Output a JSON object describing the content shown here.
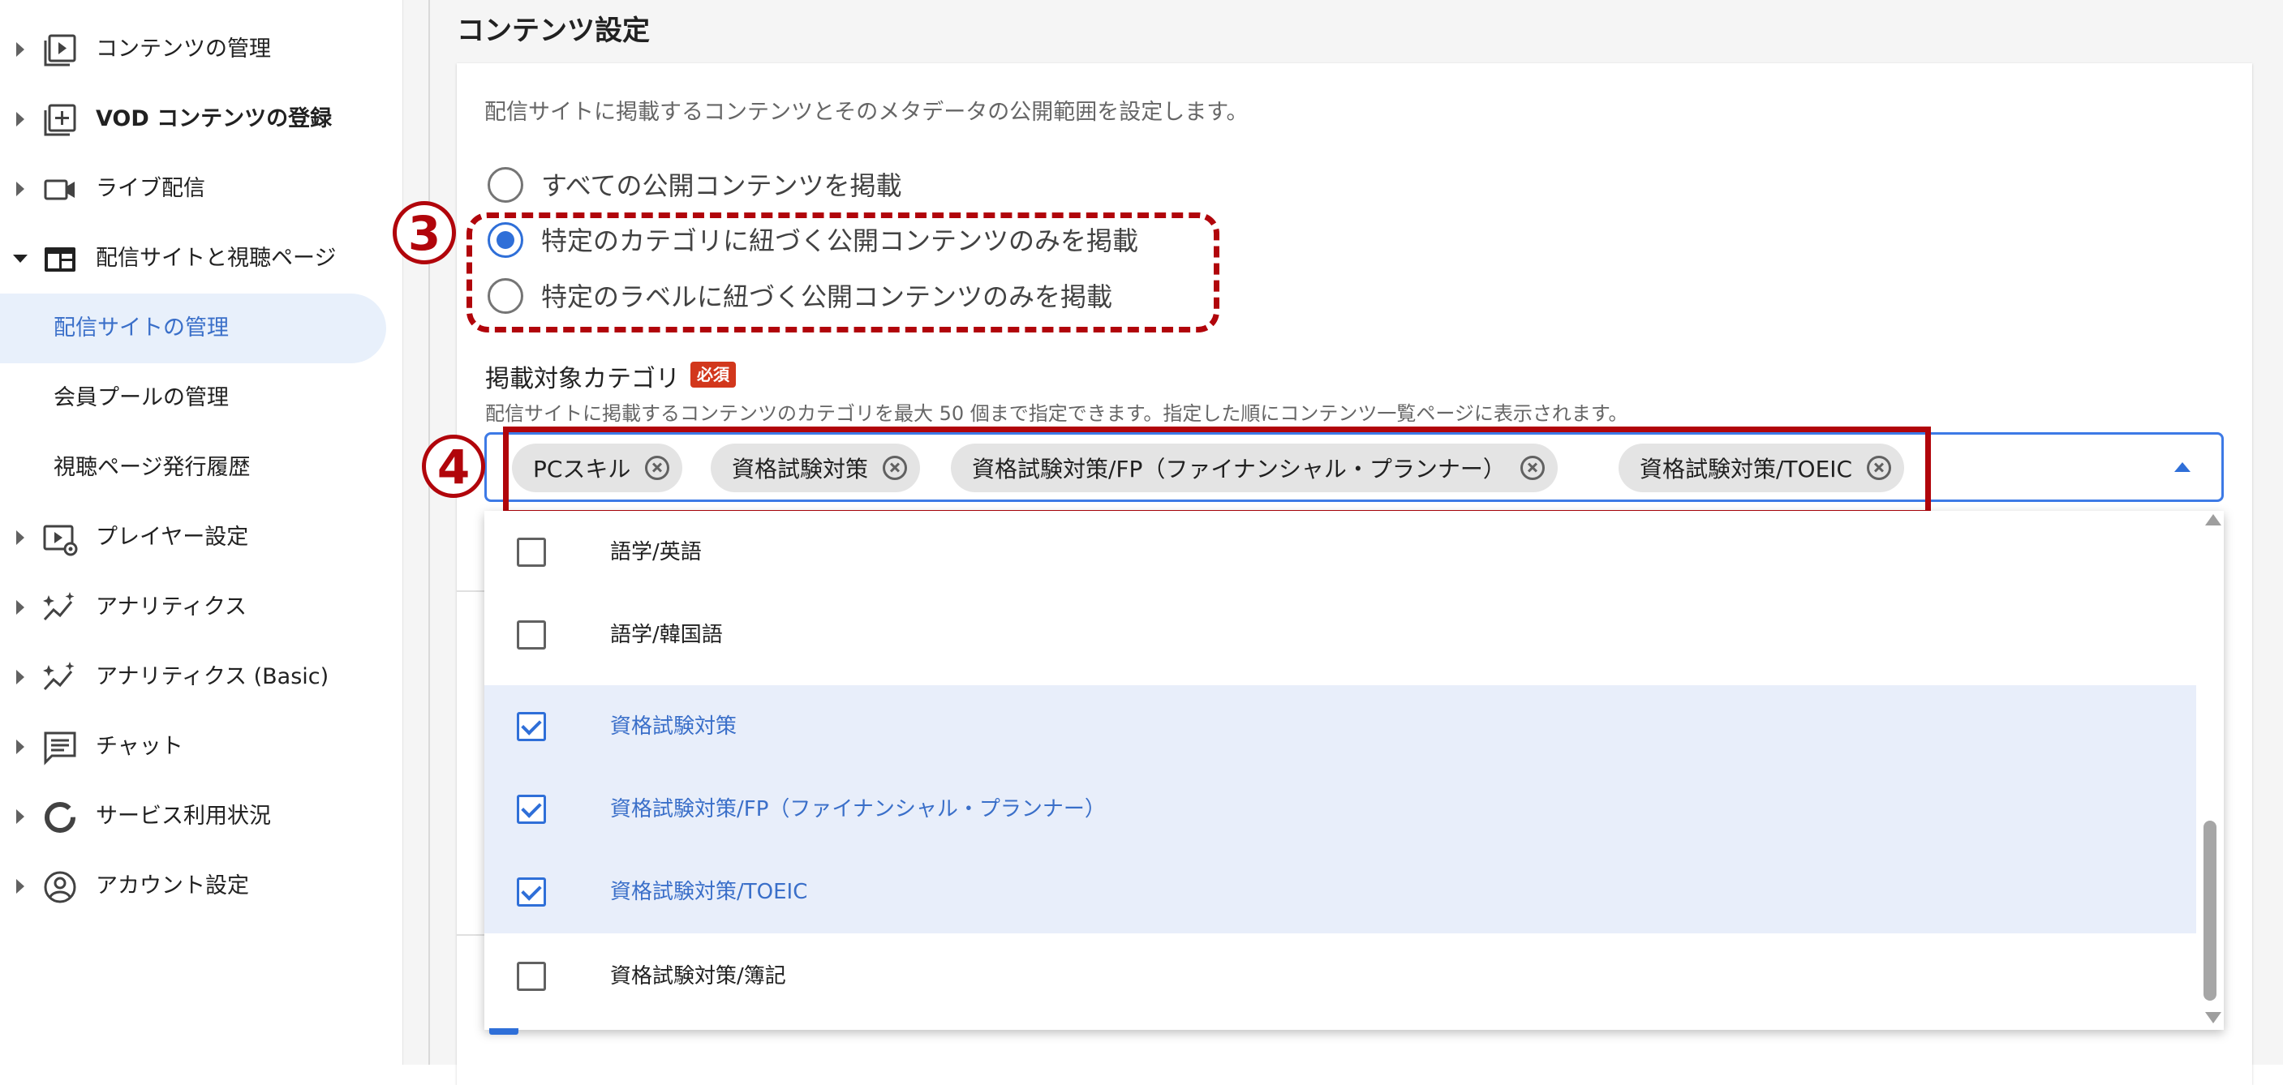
{
  "sidebar": {
    "items": [
      {
        "label": "コンテンツの管理",
        "icon": "play-library-icon"
      },
      {
        "label": "VOD コンテンツの登録",
        "icon": "add-library-icon"
      },
      {
        "label": "ライブ配信",
        "icon": "video-camera-icon"
      },
      {
        "label": "配信サイトと視聴ページ",
        "icon": "web-page-icon"
      },
      {
        "label": "プレイヤー設定",
        "icon": "player-settings-icon"
      },
      {
        "label": "アナリティクス",
        "icon": "analytics-icon"
      },
      {
        "label": "アナリティクス (Basic)",
        "icon": "analytics-icon"
      },
      {
        "label": "チャット",
        "icon": "chat-icon"
      },
      {
        "label": "サービス利用状況",
        "icon": "usage-donut-icon"
      },
      {
        "label": "アカウント設定",
        "icon": "account-circle-icon"
      }
    ],
    "sub_items": [
      {
        "label": "配信サイトの管理",
        "active": true
      },
      {
        "label": "会員プールの管理",
        "active": false
      },
      {
        "label": "視聴ページ発行履歴",
        "active": false
      }
    ]
  },
  "main": {
    "section_title": "コンテンツ設定",
    "description": "配信サイトに掲載するコンテンツとそのメタデータの公開範囲を設定します。",
    "radio_options": [
      {
        "label": "すべての公開コンテンツを掲載",
        "checked": false
      },
      {
        "label": "特定のカテゴリに紐づく公開コンテンツのみを掲載",
        "checked": true
      },
      {
        "label": "特定のラベルに紐づく公開コンテンツのみを掲載",
        "checked": false
      }
    ],
    "annotations": {
      "step3": "3",
      "step4": "4"
    },
    "category_field": {
      "label": "掲載対象カテゴリ",
      "required_badge": "必須",
      "help": "配信サイトに掲載するコンテンツのカテゴリを最大 50 個まで指定できます。指定した順にコンテンツ一覧ページに表示されます。",
      "chips": [
        "PCスキル",
        "資格試験対策",
        "資格試験対策/FP（ファイナンシャル・プランナー）",
        "資格試験対策/TOEIC"
      ]
    },
    "dropdown_options": [
      {
        "label": "語学/英語",
        "checked": false
      },
      {
        "label": "語学/韓国語",
        "checked": false
      },
      {
        "label": "資格試験対策",
        "checked": true
      },
      {
        "label": "資格試験対策/FP（ファイナンシャル・プランナー）",
        "checked": true
      },
      {
        "label": "資格試験対策/TOEIC",
        "checked": true
      },
      {
        "label": "資格試験対策/簿記",
        "checked": false
      }
    ]
  },
  "colors": {
    "accent": "#2f6fd8",
    "annotation": "#b1050b",
    "required": "#d2371c",
    "selected_row": "#e8eefa"
  }
}
